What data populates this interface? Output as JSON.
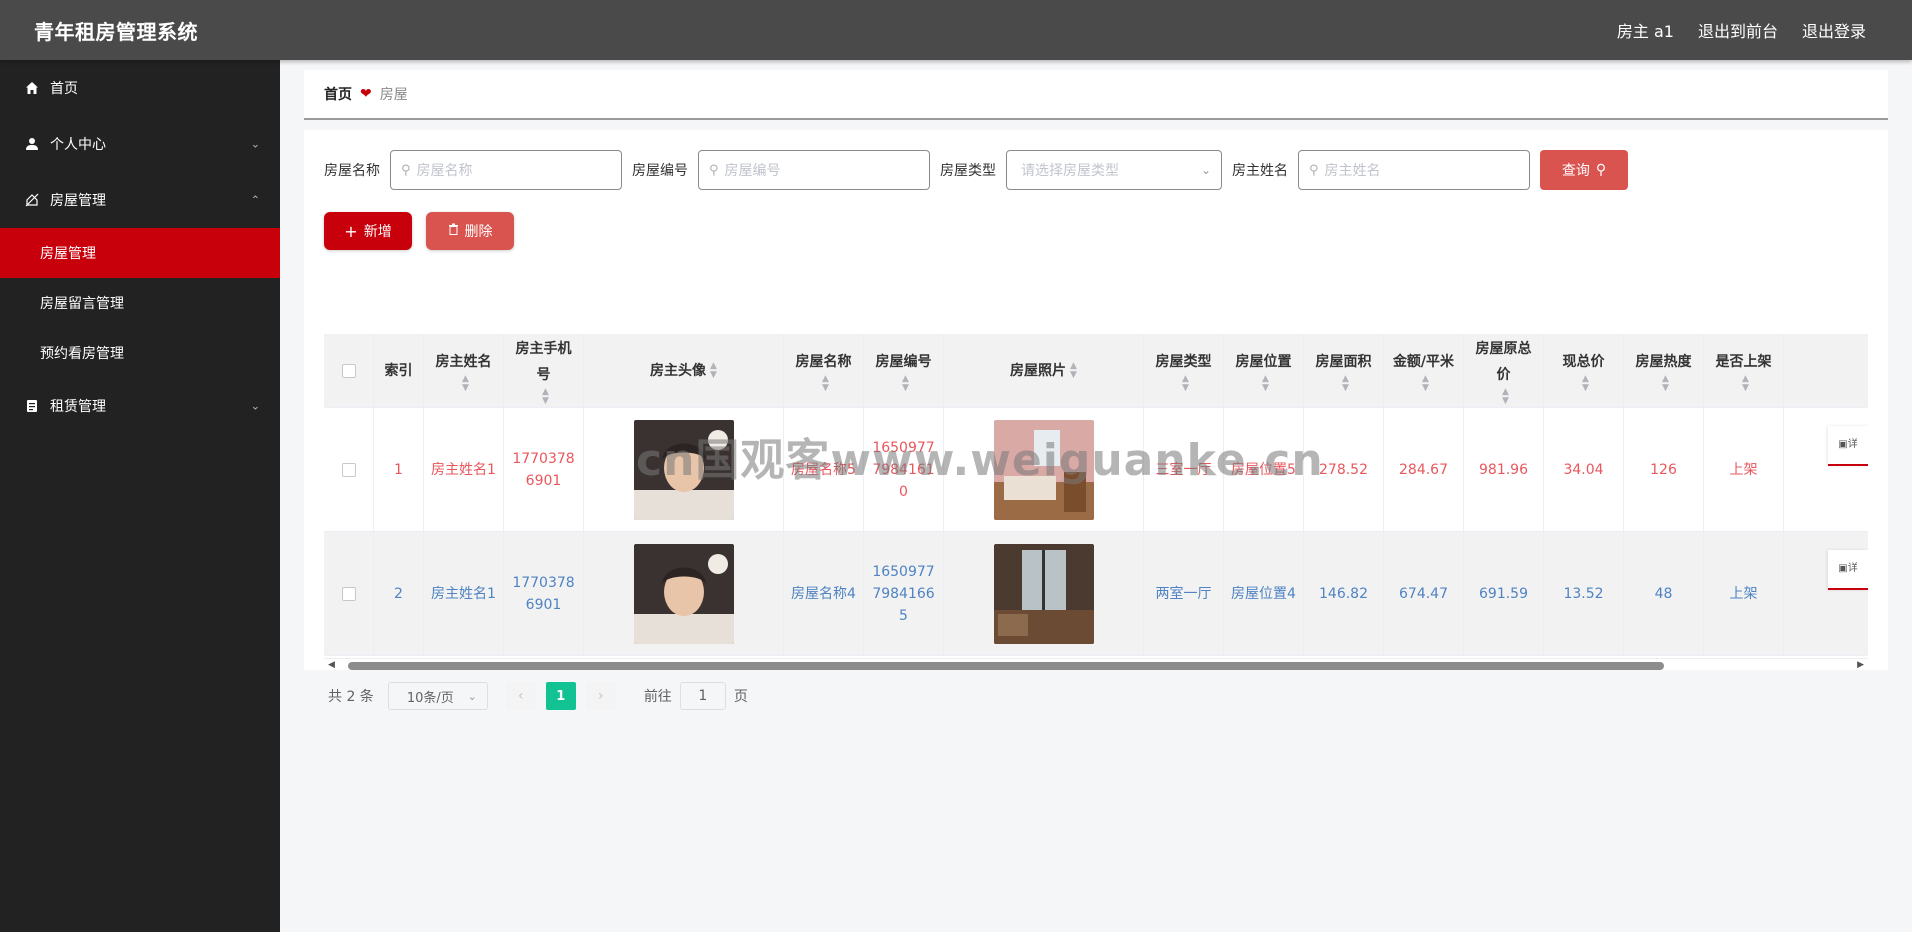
{
  "header": {
    "brand": "青年租房管理系统",
    "user_label": "房主 a1",
    "to_front": "退出到前台",
    "logout": "退出登录"
  },
  "sidebar": {
    "home": "首页",
    "personal": "个人中心",
    "house_mgmt": "房屋管理",
    "sub": [
      "房屋管理",
      "房屋留言管理",
      "预约看房管理"
    ],
    "rent": "租赁管理"
  },
  "breadcrumb": {
    "home": "首页",
    "current": "房屋"
  },
  "search": {
    "name_label": "房屋名称",
    "name_placeholder": "房屋名称",
    "no_label": "房屋编号",
    "no_placeholder": "房屋编号",
    "type_label": "房屋类型",
    "type_placeholder": "请选择房屋类型",
    "owner_label": "房主姓名",
    "owner_placeholder": "房主姓名",
    "query_btn": "查询"
  },
  "actions": {
    "add": "新增",
    "delete": "删除"
  },
  "table": {
    "headers": {
      "index": "索引",
      "owner_name": "房主姓名",
      "phone": "房主手机号",
      "avatar": "房主头像",
      "house_name": "房屋名称",
      "house_no": "房屋编号",
      "photo": "房屋照片",
      "type": "房屋类型",
      "location": "房屋位置",
      "area": "房屋面积",
      "unit_price": "金额/平米",
      "orig_total": "房屋原总价",
      "now_total": "现总价",
      "heat": "房屋热度",
      "on_shelf": "是否上架"
    },
    "rows": [
      {
        "index": "1",
        "owner_name": "房主姓名1",
        "phone": "17703786901",
        "house_name": "房屋名称5",
        "house_no": "16509777984161 0",
        "type": "三室一厅",
        "location": "房屋位置5",
        "area": "278.52",
        "unit_price": "284.67",
        "orig_total": "981.96",
        "now_total": "34.04",
        "heat": "126",
        "on_shelf": "上架"
      },
      {
        "index": "2",
        "owner_name": "房主姓名1",
        "phone": "17703786901",
        "house_name": "房屋名称4",
        "house_no": "16509777984166 5",
        "type": "两室一厅",
        "location": "房屋位置4",
        "area": "146.82",
        "unit_price": "674.47",
        "orig_total": "691.59",
        "now_total": "13.52",
        "heat": "48",
        "on_shelf": "上架"
      }
    ],
    "op_label": "详"
  },
  "pager": {
    "total": "共 2 条",
    "page_size": "10条/页",
    "current_page": "1",
    "goto_prefix": "前往",
    "goto_value": "1",
    "goto_suffix": "页"
  },
  "watermark": "cn国观客www.weiguanke.cn",
  "colors": {
    "accent": "#c8000b",
    "header_bg": "#4a4a4a",
    "sidebar_bg": "#222222",
    "page_active": "#13c293"
  }
}
